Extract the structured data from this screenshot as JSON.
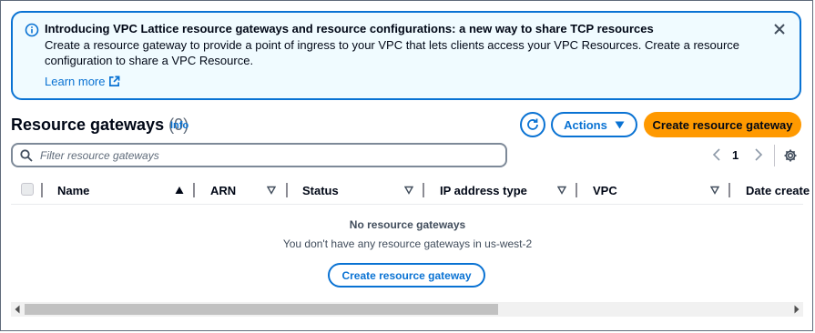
{
  "flash": {
    "title": "Introducing VPC Lattice resource gateways and resource configurations: a new way to share TCP resources",
    "body": "Create a resource gateway to provide a point of ingress to your VPC that lets clients access your VPC Resources. Create a resource configuration to share a VPC Resource.",
    "link_label": "Learn more",
    "accent_color": "#0972d3",
    "background_color": "#f0fbff",
    "icons": [
      "info-icon",
      "external-link-icon",
      "close-icon"
    ]
  },
  "header": {
    "title": "Resource gateways",
    "count": "(0)",
    "info_label": "Info",
    "actions_label": "Actions",
    "create_label": "Create resource gateway",
    "primary_color": "#ff9900",
    "icons": [
      "refresh-icon",
      "caret-down-icon"
    ]
  },
  "filter": {
    "placeholder": "Filter resource gateways",
    "value": "",
    "icon": "search-icon"
  },
  "pagination": {
    "current_page": "1",
    "icons": [
      "chevron-left-icon",
      "chevron-right-icon",
      "gear-icon"
    ]
  },
  "table": {
    "columns": [
      {
        "label": "Name",
        "sort": "ascending"
      },
      {
        "label": "ARN",
        "sort": "none"
      },
      {
        "label": "Status",
        "sort": "none"
      },
      {
        "label": "IP address type",
        "sort": "none"
      },
      {
        "label": "VPC",
        "sort": "none"
      },
      {
        "label": "Date create",
        "sort": "none"
      }
    ],
    "rows": [],
    "empty_title": "No resource gateways",
    "empty_description": "You don't have any resource gateways in us-west-2",
    "empty_button_label": "Create resource gateway"
  }
}
